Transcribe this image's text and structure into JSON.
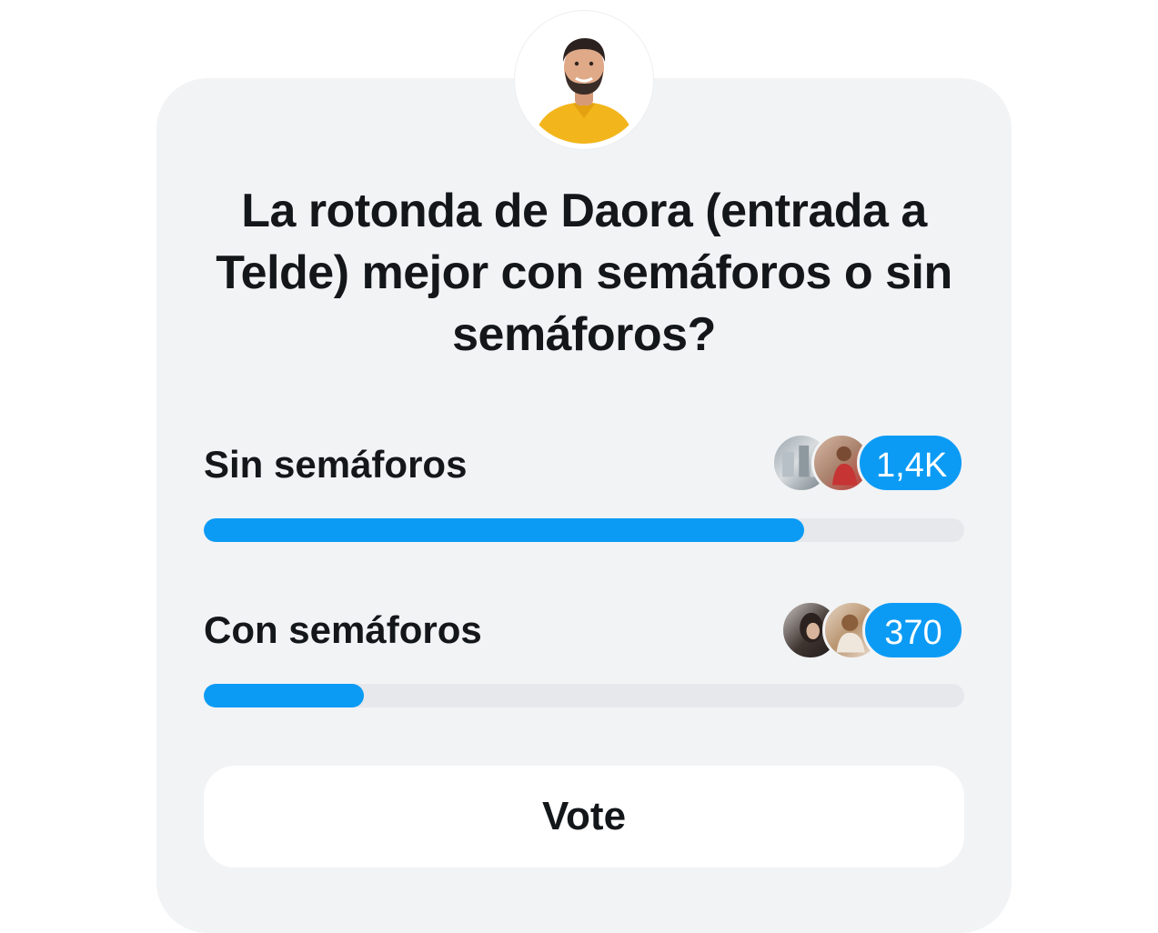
{
  "poll": {
    "question": "La rotonda de Daora (entrada a Telde) mejor con semáforos o sin semáforos?",
    "author_avatar": "person-avatar",
    "options": [
      {
        "label": "Sin semáforos",
        "count": "1,4K",
        "fill_fraction": 0.79,
        "voter_avatars": [
          "voter-avatar",
          "voter-avatar"
        ]
      },
      {
        "label": "Con semáforos",
        "count": "370",
        "fill_fraction": 0.21,
        "voter_avatars": [
          "voter-avatar",
          "voter-avatar"
        ]
      }
    ],
    "vote_label": "Vote"
  },
  "colors": {
    "accent": "#0b9bf5",
    "card_background": "#f2f3f5",
    "track": "#e6e8eb",
    "text": "#14171a"
  }
}
